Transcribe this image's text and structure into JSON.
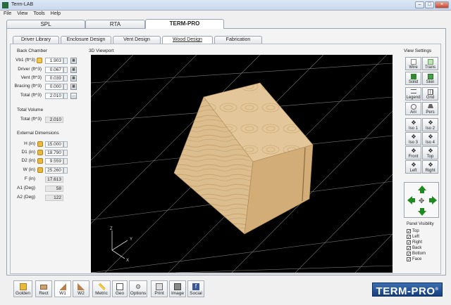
{
  "window": {
    "title": "Term-LAB",
    "min": "–",
    "max": "□",
    "close": "×"
  },
  "menu": [
    "File",
    "View",
    "Tools",
    "Help"
  ],
  "main_tabs": [
    "SPL",
    "RTA",
    "TERM-PRO"
  ],
  "sub_tabs": [
    "Driver Library",
    "Enclosure Design",
    "Vent Design",
    "Wood Design",
    "Fabrication"
  ],
  "back_chamber": {
    "title": "Back Chamber",
    "rows": [
      {
        "label": "Vb1 (ft^3)",
        "value": "1.903"
      },
      {
        "label": "Driver (ft^3)",
        "value": "0.067"
      },
      {
        "label": "Vent (ft^3)",
        "value": "0.039"
      },
      {
        "label": "Bracing (ft^3)",
        "value": "0.000"
      },
      {
        "label": "Total (ft^3)",
        "value": "2.010"
      }
    ]
  },
  "total_volume": {
    "title": "Total Volume",
    "label": "Total (ft^3)",
    "value": "2.010"
  },
  "external": {
    "title": "External Dimensions",
    "rows": [
      {
        "label": "H (in)",
        "value": "15.000"
      },
      {
        "label": "D1 (in)",
        "value": "18.790"
      },
      {
        "label": "D2 (in)",
        "value": "9.559"
      },
      {
        "label": "W (in)",
        "value": "25.260"
      },
      {
        "label": "F (in)",
        "value": "17.613"
      },
      {
        "label": "A1 (Deg)",
        "value": "58"
      },
      {
        "label": "A2 (Deg)",
        "value": "122"
      }
    ]
  },
  "viewport": {
    "title": "3D Viewport",
    "axes": {
      "x": "X",
      "y": "Y",
      "z": "Z"
    }
  },
  "view_settings": {
    "title": "View Settings",
    "buttons": [
      "Wire",
      "Trans",
      "Solid",
      "Skin",
      "Legend",
      "Grid",
      "Ani",
      "Pers",
      "Iso 1",
      "Iso 2",
      "Iso 3",
      "Iso 4",
      "Front",
      "Top",
      "Left",
      "Right"
    ]
  },
  "panel_visibility": {
    "title": "Panel Visibility",
    "items": [
      {
        "label": "Top",
        "checked": true
      },
      {
        "label": "Left",
        "checked": true
      },
      {
        "label": "Right",
        "checked": true
      },
      {
        "label": "Back",
        "checked": true
      },
      {
        "label": "Bottom",
        "checked": true
      },
      {
        "label": "Face",
        "checked": true
      }
    ]
  },
  "toolbar": [
    "Golden",
    "Rect",
    "W1",
    "W2",
    "Metric",
    "Geo",
    "Options",
    "Print",
    "Image",
    "Social"
  ],
  "logo": "TERM-PRO",
  "logo_mark": "®",
  "colors": {
    "accent": "#2a8a2a",
    "wood": "#d9b98a",
    "viewport_bg": "#000000",
    "grid": "#8a8a8a"
  }
}
